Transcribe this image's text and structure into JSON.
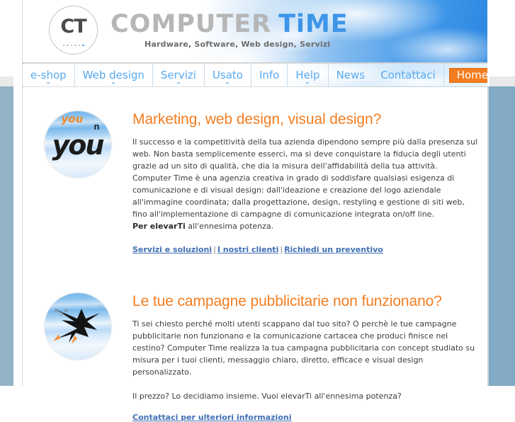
{
  "frame": {
    "left_band_color": "#93b2c6",
    "right_band_color": "#82aac4"
  },
  "header": {
    "logo_mark_text": "CT",
    "brand_part1": "COMPUTER",
    "brand_part2": "TiME",
    "tagline": "Hardware, Software, Web design, Servizi",
    "brand_color_1": "#b6b6b6",
    "brand_color_2": "#3d95e8"
  },
  "nav": {
    "left_items": [
      {
        "label": "e-shop",
        "has_dropdown": true
      },
      {
        "label": "Web design",
        "has_dropdown": true
      },
      {
        "label": "Servizi",
        "has_dropdown": true
      },
      {
        "label": "Usato",
        "has_dropdown": true
      },
      {
        "label": "Info",
        "has_dropdown": false
      },
      {
        "label": "Help",
        "has_dropdown": true
      },
      {
        "label": "News",
        "has_dropdown": false
      }
    ],
    "right_items": [
      {
        "label": "Contattaci",
        "active": false
      },
      {
        "label": "Home",
        "active": true
      }
    ],
    "link_color": "#56a9f0",
    "active_bg": "#f47d20"
  },
  "sections": [
    {
      "image": {
        "name": "you-n-circle-image",
        "big_text": "you",
        "small_text": "you",
        "exponent": "n"
      },
      "heading": "Marketing, web design, visual design?",
      "paragraph_1": "Il successo e la competitività della tua azienda dipendono sempre più dalla presenza sul web. Non basta semplicemente esserci, ma si deve conquistare la fiducia degli utenti grazie ad un sito di qualità, che dia la misura dell'affidabilità della tua attività.",
      "paragraph_2": "Computer Time è una agenzia creativa in grado di soddisfare qualsiasi esigenza di comunicazione e di visual design: dall'ideazione e creazione del logo aziendale all'immagine coordinata; dalla  progettazione, design, restyling e gestione di siti web, fino all'implementazione di campagne di comunicazione integrata on/off line.",
      "paragraph_3_bold": "Per elevarTi",
      "paragraph_3_rest": " all'ennesima potenza.",
      "links": [
        "Servizi e soluzioni",
        "I nostri clienti",
        "Richiedi un preventivo"
      ],
      "link_separator": "|"
    },
    {
      "image": {
        "name": "flying-figure-circle-image"
      },
      "heading": "Le tue campagne pubblicitarie non funzionano?",
      "paragraph_1": "Ti sei chiesto perché molti utenti scappano dal tuo sito? O perchè le tue campagne pubblicitarie non funzionano e la comunicazione cartacea che produci finisce nel cestino? Computer Time realizza la tua campagna pubblicitaria con concept studiato su misura per i tuoi clienti, messaggio chiaro, diretto, efficace e visual design personalizzato.",
      "paragraph_2": "Il prezzo? Lo decidiamo insieme. Vuoi elevarTi all'ennesima potenza?",
      "link": "Contattaci per ulteriori informazioni"
    }
  ]
}
